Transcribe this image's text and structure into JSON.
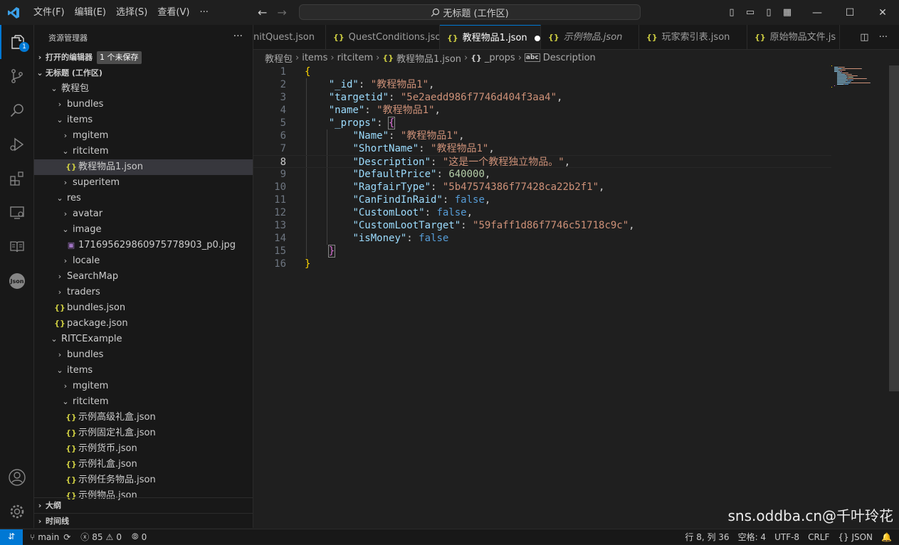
{
  "titlebar": {
    "menu": [
      "文件(F)",
      "编辑(E)",
      "选择(S)",
      "查看(V)",
      "···"
    ],
    "search_text": "无标题 (工作区)"
  },
  "activity": {
    "explorer_badge": "1"
  },
  "sidebar": {
    "title": "资源管理器",
    "open_editors_label": "打开的编辑器",
    "unsaved_badge": "1 个未保存",
    "workspace_label": "无标题 (工作区)",
    "tree": [
      {
        "label": "教程包",
        "depth": 1,
        "twisty": "open"
      },
      {
        "label": "bundles",
        "depth": 2,
        "twisty": "closed"
      },
      {
        "label": "items",
        "depth": 2,
        "twisty": "open"
      },
      {
        "label": "mgitem",
        "depth": 3,
        "twisty": "closed"
      },
      {
        "label": "ritcitem",
        "depth": 3,
        "twisty": "open"
      },
      {
        "label": "教程物品1.json",
        "depth": 4,
        "icon": "json",
        "selected": true
      },
      {
        "label": "superitem",
        "depth": 3,
        "twisty": "closed"
      },
      {
        "label": "res",
        "depth": 2,
        "twisty": "open"
      },
      {
        "label": "avatar",
        "depth": 3,
        "twisty": "closed"
      },
      {
        "label": "image",
        "depth": 3,
        "twisty": "open"
      },
      {
        "label": "171695629860975778903_p0.jpg",
        "depth": 4,
        "icon": "image"
      },
      {
        "label": "locale",
        "depth": 3,
        "twisty": "closed"
      },
      {
        "label": "SearchMap",
        "depth": 2,
        "twisty": "closed"
      },
      {
        "label": "traders",
        "depth": 2,
        "twisty": "closed"
      },
      {
        "label": "bundles.json",
        "depth": 2,
        "icon": "json"
      },
      {
        "label": "package.json",
        "depth": 2,
        "icon": "json"
      },
      {
        "label": "RITCExample",
        "depth": 1,
        "twisty": "open"
      },
      {
        "label": "bundles",
        "depth": 2,
        "twisty": "closed"
      },
      {
        "label": "items",
        "depth": 2,
        "twisty": "open"
      },
      {
        "label": "mgitem",
        "depth": 3,
        "twisty": "closed"
      },
      {
        "label": "ritcitem",
        "depth": 3,
        "twisty": "open"
      },
      {
        "label": "示例高级礼盒.json",
        "depth": 4,
        "icon": "json"
      },
      {
        "label": "示例固定礼盒.json",
        "depth": 4,
        "icon": "json"
      },
      {
        "label": "示例货币.json",
        "depth": 4,
        "icon": "json"
      },
      {
        "label": "示例礼盒.json",
        "depth": 4,
        "icon": "json"
      },
      {
        "label": "示例任务物品.json",
        "depth": 4,
        "icon": "json"
      },
      {
        "label": "示例物品.json",
        "depth": 4,
        "icon": "json"
      }
    ],
    "outline_label": "大纲",
    "timeline_label": "时间线"
  },
  "tabs": [
    {
      "label": "nitQuest.json",
      "icon": false,
      "active": false
    },
    {
      "label": "QuestConditions.json",
      "icon": true,
      "active": false
    },
    {
      "label": "教程物品1.json",
      "icon": true,
      "active": true,
      "dirty": true
    },
    {
      "label": "示例物品.json",
      "icon": true,
      "active": false,
      "italic": true
    },
    {
      "label": "玩家索引表.json",
      "icon": true,
      "active": false
    },
    {
      "label": "原始物品文件.js",
      "icon": true,
      "active": false
    }
  ],
  "breadcrumb": [
    "教程包",
    "items",
    "ritcitem",
    "教程物品1.json",
    "_props",
    "Description"
  ],
  "editor": {
    "current_line": 8,
    "lines": [
      [
        [
          "br1",
          "{"
        ]
      ],
      [
        [
          "p",
          "    "
        ],
        [
          "k",
          "\"_id\""
        ],
        [
          "p",
          ": "
        ],
        [
          "s",
          "\"教程物品1\""
        ],
        [
          "p",
          ","
        ]
      ],
      [
        [
          "p",
          "    "
        ],
        [
          "k",
          "\"targetid\""
        ],
        [
          "p",
          ": "
        ],
        [
          "s",
          "\"5e2aedd986f7746d404f3aa4\""
        ],
        [
          "p",
          ","
        ]
      ],
      [
        [
          "p",
          "    "
        ],
        [
          "k",
          "\"name\""
        ],
        [
          "p",
          ": "
        ],
        [
          "s",
          "\"教程物品1\""
        ],
        [
          "p",
          ","
        ]
      ],
      [
        [
          "p",
          "    "
        ],
        [
          "k",
          "\"_props\""
        ],
        [
          "p",
          ": "
        ],
        [
          "br2",
          "{"
        ]
      ],
      [
        [
          "p",
          "        "
        ],
        [
          "k",
          "\"Name\""
        ],
        [
          "p",
          ": "
        ],
        [
          "s",
          "\"教程物品1\""
        ],
        [
          "p",
          ","
        ]
      ],
      [
        [
          "p",
          "        "
        ],
        [
          "k",
          "\"ShortName\""
        ],
        [
          "p",
          ": "
        ],
        [
          "s",
          "\"教程物品1\""
        ],
        [
          "p",
          ","
        ]
      ],
      [
        [
          "p",
          "        "
        ],
        [
          "k",
          "\"Description\""
        ],
        [
          "p",
          ": "
        ],
        [
          "s",
          "\"这是一个教程独立物品。\""
        ],
        [
          "p",
          ","
        ]
      ],
      [
        [
          "p",
          "        "
        ],
        [
          "k",
          "\"DefaultPrice\""
        ],
        [
          "p",
          ": "
        ],
        [
          "n",
          "640000"
        ],
        [
          "p",
          ","
        ]
      ],
      [
        [
          "p",
          "        "
        ],
        [
          "k",
          "\"RagfairType\""
        ],
        [
          "p",
          ": "
        ],
        [
          "s",
          "\"5b47574386f77428ca22b2f1\""
        ],
        [
          "p",
          ","
        ]
      ],
      [
        [
          "p",
          "        "
        ],
        [
          "k",
          "\"CanFindInRaid\""
        ],
        [
          "p",
          ": "
        ],
        [
          "b",
          "false"
        ],
        [
          "p",
          ","
        ]
      ],
      [
        [
          "p",
          "        "
        ],
        [
          "k",
          "\"CustomLoot\""
        ],
        [
          "p",
          ": "
        ],
        [
          "b",
          "false"
        ],
        [
          "p",
          ","
        ]
      ],
      [
        [
          "p",
          "        "
        ],
        [
          "k",
          "\"CustomLootTarget\""
        ],
        [
          "p",
          ": "
        ],
        [
          "s",
          "\"59faff1d86f7746c51718c9c\""
        ],
        [
          "p",
          ","
        ]
      ],
      [
        [
          "p",
          "        "
        ],
        [
          "k",
          "\"isMoney\""
        ],
        [
          "p",
          ": "
        ],
        [
          "b",
          "false"
        ]
      ],
      [
        [
          "p",
          "    "
        ],
        [
          "br2",
          "}"
        ]
      ],
      [
        [
          "br1",
          "}"
        ]
      ]
    ]
  },
  "status": {
    "branch": "main",
    "errors": "85",
    "warnings": "0",
    "ports": "0",
    "position": "行 8, 列 36",
    "spaces": "空格: 4",
    "encoding": "UTF-8",
    "eol": "CRLF",
    "language": "{} JSON"
  },
  "watermark": "sns.oddba.cn@千叶玲花"
}
